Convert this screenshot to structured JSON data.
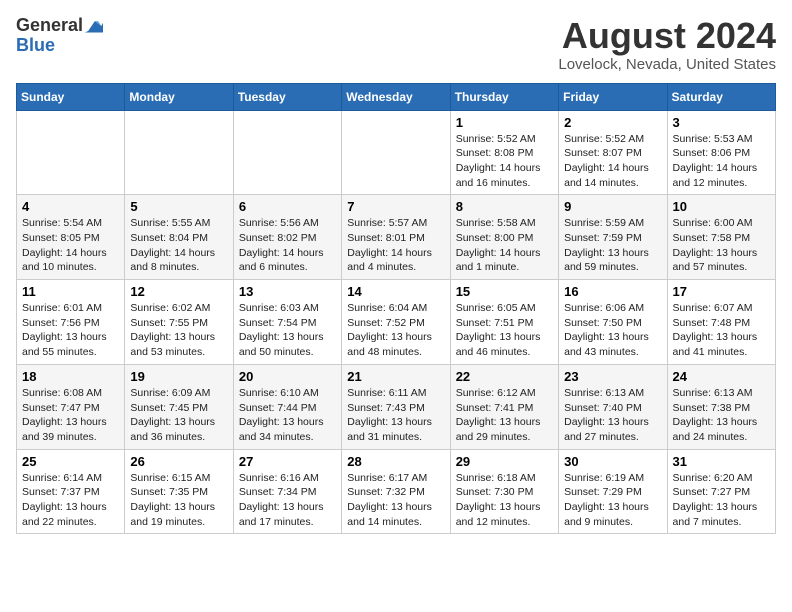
{
  "logo": {
    "general": "General",
    "blue": "Blue"
  },
  "title": {
    "month": "August 2024",
    "location": "Lovelock, Nevada, United States"
  },
  "weekdays": [
    "Sunday",
    "Monday",
    "Tuesday",
    "Wednesday",
    "Thursday",
    "Friday",
    "Saturday"
  ],
  "weeks": [
    [
      {
        "day": "",
        "info": ""
      },
      {
        "day": "",
        "info": ""
      },
      {
        "day": "",
        "info": ""
      },
      {
        "day": "",
        "info": ""
      },
      {
        "day": "1",
        "info": "Sunrise: 5:52 AM\nSunset: 8:08 PM\nDaylight: 14 hours\nand 16 minutes."
      },
      {
        "day": "2",
        "info": "Sunrise: 5:52 AM\nSunset: 8:07 PM\nDaylight: 14 hours\nand 14 minutes."
      },
      {
        "day": "3",
        "info": "Sunrise: 5:53 AM\nSunset: 8:06 PM\nDaylight: 14 hours\nand 12 minutes."
      }
    ],
    [
      {
        "day": "4",
        "info": "Sunrise: 5:54 AM\nSunset: 8:05 PM\nDaylight: 14 hours\nand 10 minutes."
      },
      {
        "day": "5",
        "info": "Sunrise: 5:55 AM\nSunset: 8:04 PM\nDaylight: 14 hours\nand 8 minutes."
      },
      {
        "day": "6",
        "info": "Sunrise: 5:56 AM\nSunset: 8:02 PM\nDaylight: 14 hours\nand 6 minutes."
      },
      {
        "day": "7",
        "info": "Sunrise: 5:57 AM\nSunset: 8:01 PM\nDaylight: 14 hours\nand 4 minutes."
      },
      {
        "day": "8",
        "info": "Sunrise: 5:58 AM\nSunset: 8:00 PM\nDaylight: 14 hours\nand 1 minute."
      },
      {
        "day": "9",
        "info": "Sunrise: 5:59 AM\nSunset: 7:59 PM\nDaylight: 13 hours\nand 59 minutes."
      },
      {
        "day": "10",
        "info": "Sunrise: 6:00 AM\nSunset: 7:58 PM\nDaylight: 13 hours\nand 57 minutes."
      }
    ],
    [
      {
        "day": "11",
        "info": "Sunrise: 6:01 AM\nSunset: 7:56 PM\nDaylight: 13 hours\nand 55 minutes."
      },
      {
        "day": "12",
        "info": "Sunrise: 6:02 AM\nSunset: 7:55 PM\nDaylight: 13 hours\nand 53 minutes."
      },
      {
        "day": "13",
        "info": "Sunrise: 6:03 AM\nSunset: 7:54 PM\nDaylight: 13 hours\nand 50 minutes."
      },
      {
        "day": "14",
        "info": "Sunrise: 6:04 AM\nSunset: 7:52 PM\nDaylight: 13 hours\nand 48 minutes."
      },
      {
        "day": "15",
        "info": "Sunrise: 6:05 AM\nSunset: 7:51 PM\nDaylight: 13 hours\nand 46 minutes."
      },
      {
        "day": "16",
        "info": "Sunrise: 6:06 AM\nSunset: 7:50 PM\nDaylight: 13 hours\nand 43 minutes."
      },
      {
        "day": "17",
        "info": "Sunrise: 6:07 AM\nSunset: 7:48 PM\nDaylight: 13 hours\nand 41 minutes."
      }
    ],
    [
      {
        "day": "18",
        "info": "Sunrise: 6:08 AM\nSunset: 7:47 PM\nDaylight: 13 hours\nand 39 minutes."
      },
      {
        "day": "19",
        "info": "Sunrise: 6:09 AM\nSunset: 7:45 PM\nDaylight: 13 hours\nand 36 minutes."
      },
      {
        "day": "20",
        "info": "Sunrise: 6:10 AM\nSunset: 7:44 PM\nDaylight: 13 hours\nand 34 minutes."
      },
      {
        "day": "21",
        "info": "Sunrise: 6:11 AM\nSunset: 7:43 PM\nDaylight: 13 hours\nand 31 minutes."
      },
      {
        "day": "22",
        "info": "Sunrise: 6:12 AM\nSunset: 7:41 PM\nDaylight: 13 hours\nand 29 minutes."
      },
      {
        "day": "23",
        "info": "Sunrise: 6:13 AM\nSunset: 7:40 PM\nDaylight: 13 hours\nand 27 minutes."
      },
      {
        "day": "24",
        "info": "Sunrise: 6:13 AM\nSunset: 7:38 PM\nDaylight: 13 hours\nand 24 minutes."
      }
    ],
    [
      {
        "day": "25",
        "info": "Sunrise: 6:14 AM\nSunset: 7:37 PM\nDaylight: 13 hours\nand 22 minutes."
      },
      {
        "day": "26",
        "info": "Sunrise: 6:15 AM\nSunset: 7:35 PM\nDaylight: 13 hours\nand 19 minutes."
      },
      {
        "day": "27",
        "info": "Sunrise: 6:16 AM\nSunset: 7:34 PM\nDaylight: 13 hours\nand 17 minutes."
      },
      {
        "day": "28",
        "info": "Sunrise: 6:17 AM\nSunset: 7:32 PM\nDaylight: 13 hours\nand 14 minutes."
      },
      {
        "day": "29",
        "info": "Sunrise: 6:18 AM\nSunset: 7:30 PM\nDaylight: 13 hours\nand 12 minutes."
      },
      {
        "day": "30",
        "info": "Sunrise: 6:19 AM\nSunset: 7:29 PM\nDaylight: 13 hours\nand 9 minutes."
      },
      {
        "day": "31",
        "info": "Sunrise: 6:20 AM\nSunset: 7:27 PM\nDaylight: 13 hours\nand 7 minutes."
      }
    ]
  ]
}
